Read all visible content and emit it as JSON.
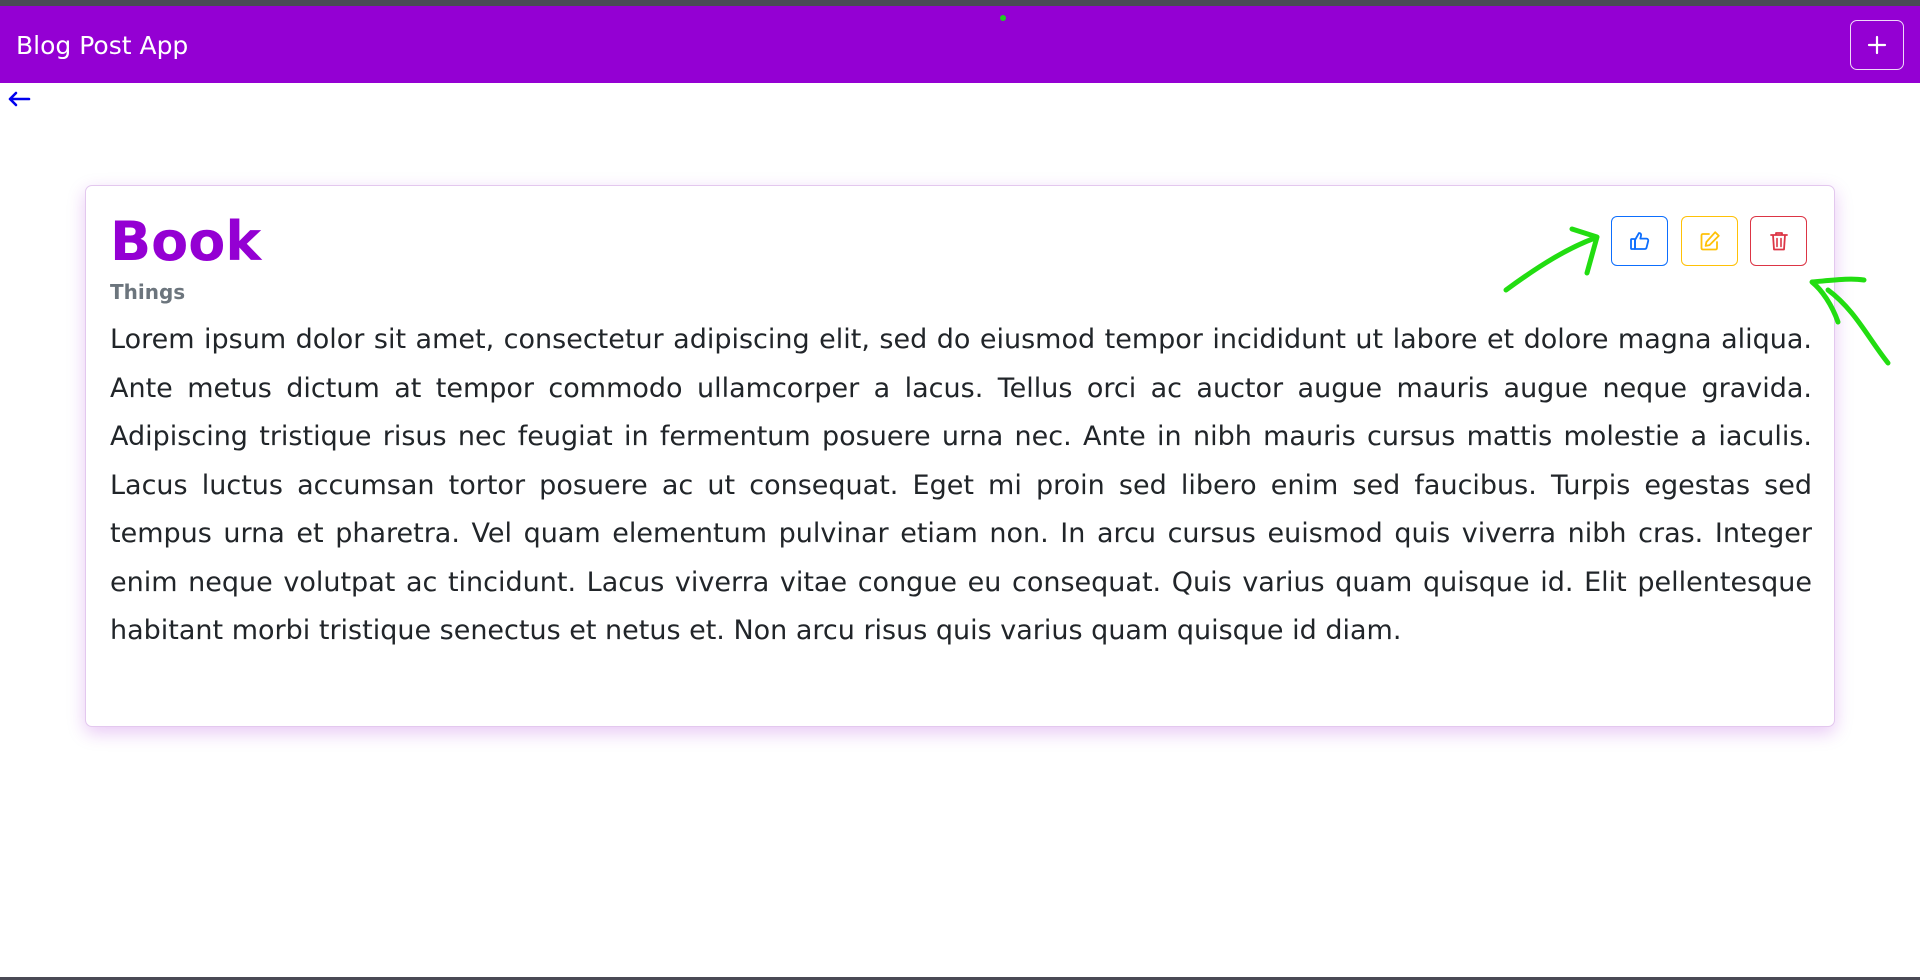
{
  "navbar": {
    "brand": "Blog Post App",
    "add_icon": "plus-icon",
    "color": "#9400d3"
  },
  "back": {
    "icon": "arrow-left-icon",
    "color": "#0000ee"
  },
  "post": {
    "title": "Book",
    "category": "Things",
    "body": "Lorem ipsum dolor sit amet, consectetur adipiscing elit, sed do eiusmod tempor incididunt ut labore et dolore magna aliqua. Ante metus dictum at tempor commodo ullamcorper a lacus. Tellus orci ac auctor augue mauris augue neque gravida. Adipiscing tristique risus nec feugiat in fermentum posuere urna nec. Ante in nibh mauris cursus mattis molestie a iaculis. Lacus luctus accumsan tortor posuere ac ut consequat. Eget mi proin sed libero enim sed faucibus. Turpis egestas sed tempus urna et pharetra. Vel quam elementum pulvinar etiam non. In arcu cursus euismod quis viverra nibh cras. Integer enim neque volutpat ac tincidunt. Lacus viverra vitae congue eu consequat. Quis varius quam quisque id. Elit pellentesque habitant morbi tristique senectus et netus et. Non arcu risus quis varius quam quisque id diam."
  },
  "actions": {
    "like": {
      "icon": "thumbs-up-icon",
      "color": "#0d6efd"
    },
    "edit": {
      "icon": "pencil-square-icon",
      "color": "#ffc107"
    },
    "delete": {
      "icon": "trash-icon",
      "color": "#dc3545"
    }
  },
  "annotations": {
    "icon": "green-arrow-icon",
    "color": "#22dd11"
  }
}
